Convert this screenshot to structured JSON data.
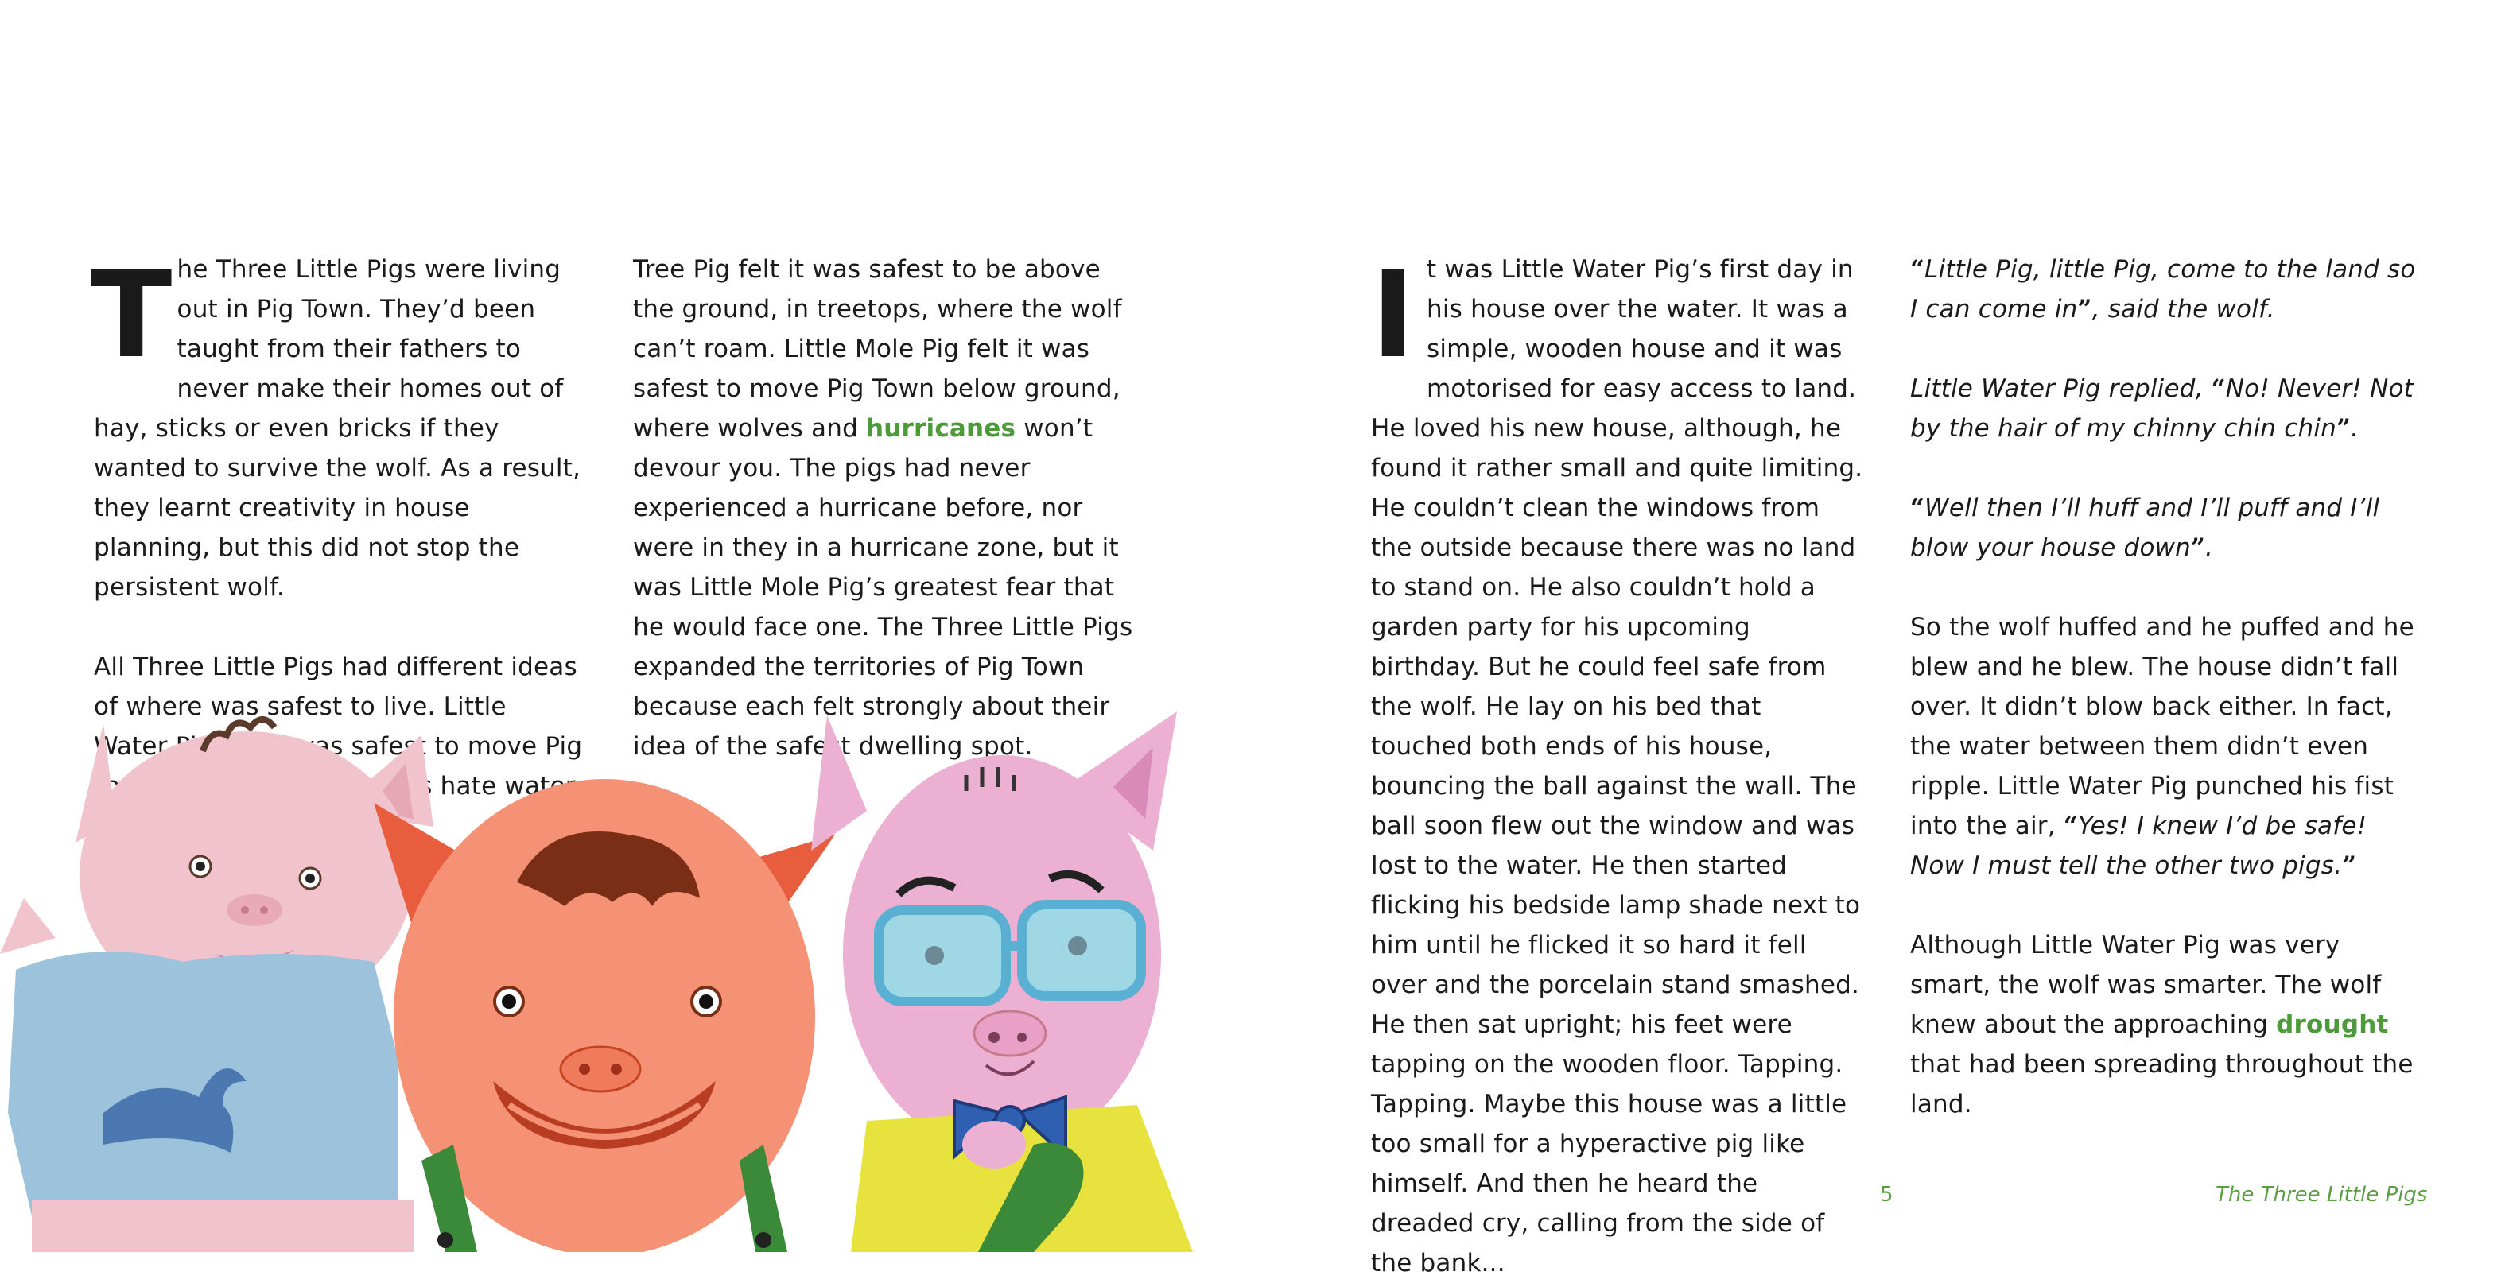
{
  "left_page": {
    "col1": {
      "dropcap": "T",
      "para1": "he Three Little Pigs were living out in Pig Town. They’d been taught from their fathers to never make their homes out of hay, sticks or even bricks if they wanted to survive the wolf. As a result, they learnt creativity in house planning, but this did not stop the persistent wolf.",
      "para2": "All Three Little Pigs had different ideas of where was safest to live. Little Water Pig felt it was safest to move Pig Town over the lake. Wolves hate water, he thought. Little"
    },
    "col2": {
      "text_a": "Tree Pig felt it was safest to be above the ground, in treetops, where the wolf can’t roam. Little Mole Pig felt it was safest to move Pig Town below ground, where wolves and ",
      "highlight": "hurricanes",
      "text_b": " won’t devour you. The pigs had never experienced a hurricane before, nor were in they in a hurricane zone, but it was Little Mole Pig’s greatest fear that he would face one. The Three Little Pigs expanded the territories of Pig Town because each felt strongly about their idea of the safest dwelling spot."
    }
  },
  "right_page": {
    "col3": {
      "dropcap": "I",
      "para": "t was Little Water Pig’s first day in his house over the water. It was a simple, wooden house and it was motorised for easy access to land. He loved his new house, although, he found it rather small and quite limiting. He couldn’t clean the windows from the outside because there was no land to stand on. He also couldn’t hold a garden party for his upcoming birthday. But he could feel safe from the wolf. He lay on his bed that touched both ends of his house, bouncing the ball against the wall. The ball soon flew out the window and was lost to the water. He then started flicking his bedside lamp shade next to him until he flicked it so hard it fell over and the porcelain stand smashed. He then sat upright; his feet were tapping on the wooden floor. Tapping. Tapping. Maybe this house was a little too small for a hyperactive pig like himself. And then he heard the dreaded cry, calling from the side of the bank..."
    },
    "col4": {
      "q1_open": "“",
      "q1_text": "Little Pig, little Pig, come to the land so I can come in",
      "q1_close": "”",
      "q1_tail": ", said the wolf.",
      "q2_lead": " Little Water Pig replied, ",
      "q2_open": "“",
      "q2_text": "No! Never! Not by the hair of my chinny chin chin",
      "q2_close": "”",
      "q2_tail": ".",
      "q3_open": "“",
      "q3_text": "Well then I’ll huff and I’ll puff and I’ll blow your house down",
      "q3_close": "”",
      "q3_tail": ".",
      "p4_text": "So the wolf huffed and he puffed and he blew and he blew. The house didn’t fall over. It didn’t blow back either. In fact, the water between them didn’t even ripple. Little Water Pig punched his fist into the air, ",
      "p4_open": "“",
      "p4_quote": "Yes! I knew I’d be safe! Now I must tell the other two pigs.",
      "p4_close": "”",
      "p5_a": "Although Little Water Pig was very smart, the wolf was smarter. The wolf knew about the approaching ",
      "p5_highlight": "drought",
      "p5_b": " that had been spreading throughout the land."
    },
    "footer": {
      "page_number": "5",
      "book_title": "The Three Little Pigs"
    }
  },
  "colors": {
    "highlight_green": "#4c9a3a",
    "footer_green": "#5aa043"
  },
  "illustration": {
    "icons": [
      "water-pig",
      "mole-pig",
      "tree-pig"
    ]
  }
}
